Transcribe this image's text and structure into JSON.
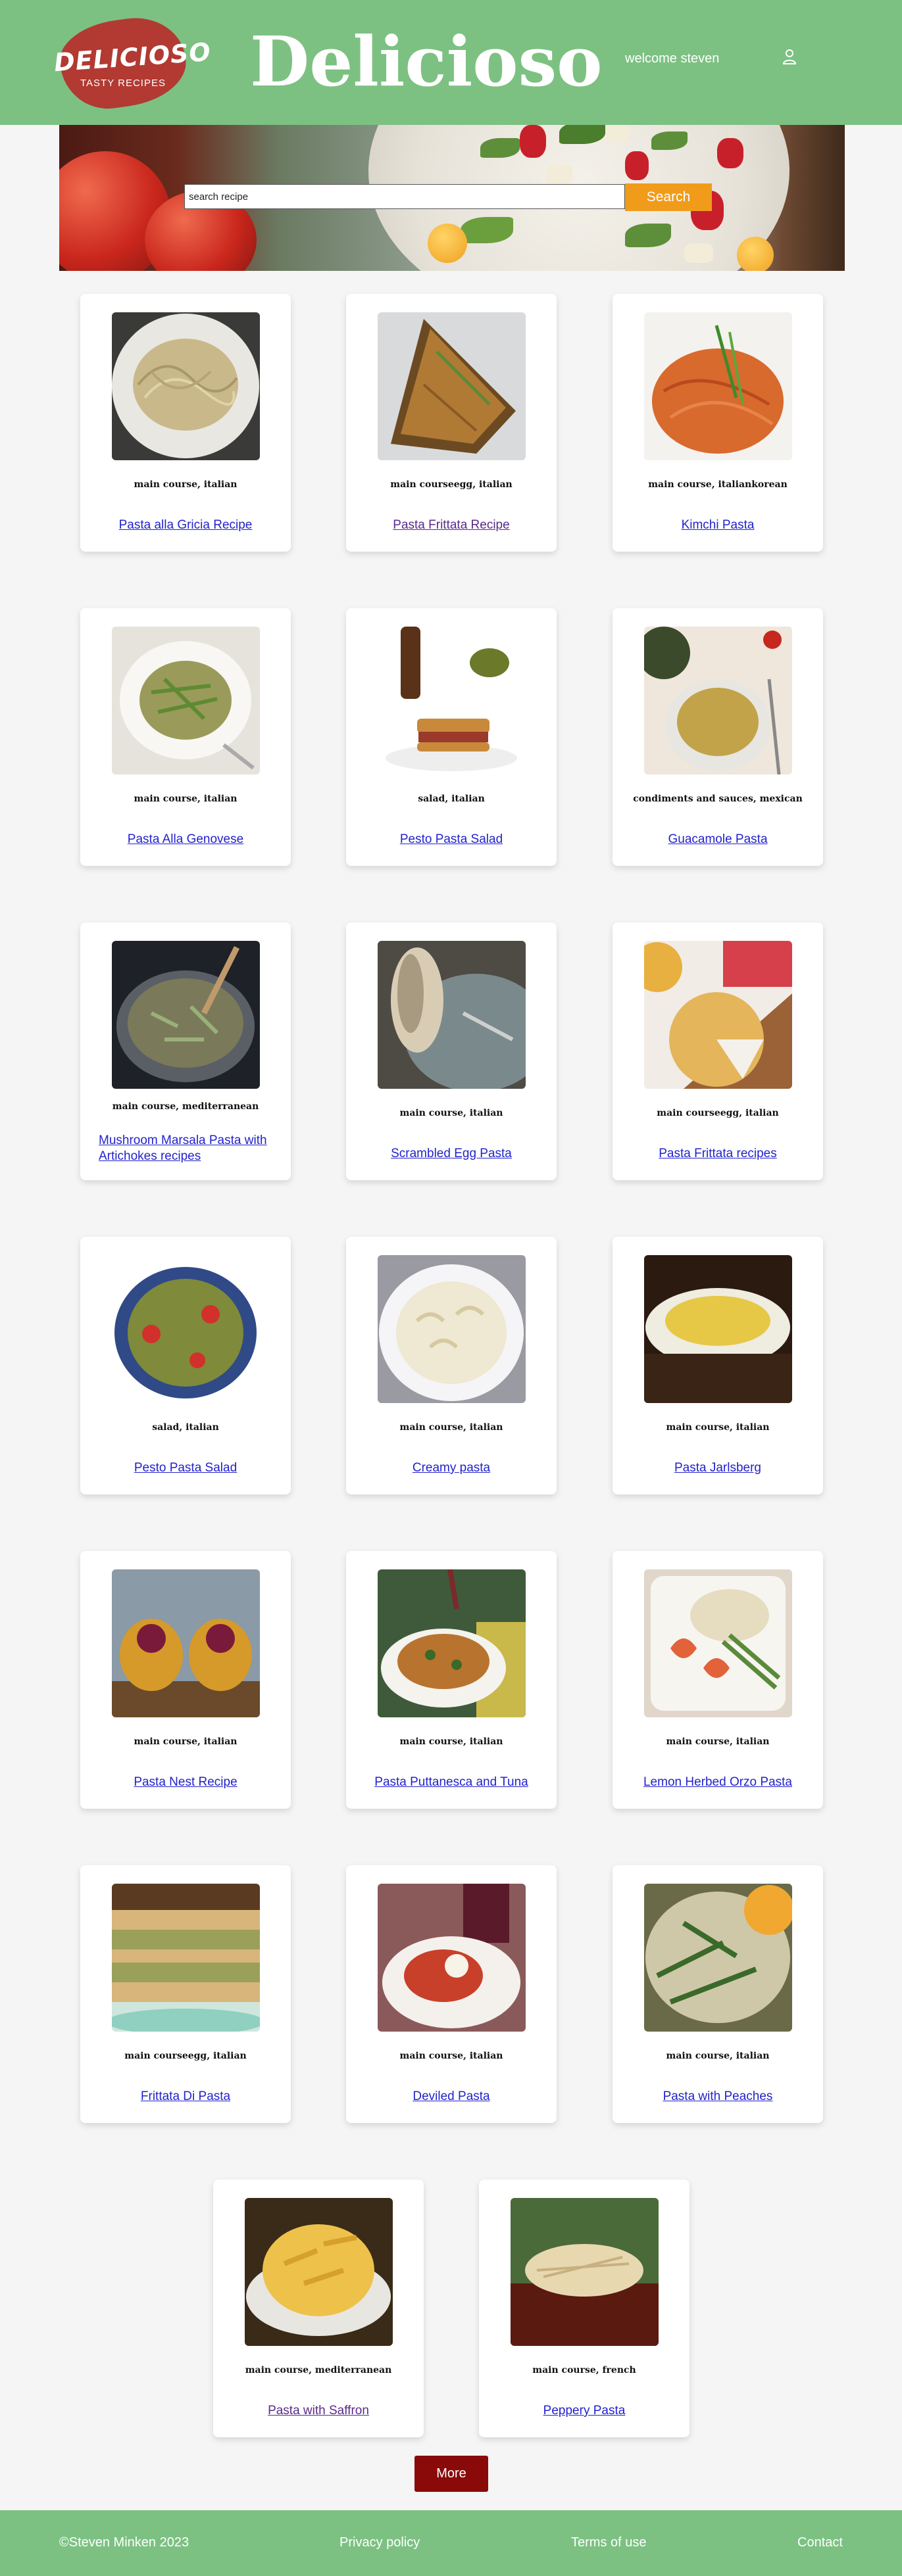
{
  "header": {
    "logo_title": "DELICIOSO",
    "logo_subtitle": "TASTY RECIPES",
    "brand": "Delicioso",
    "welcome": "welcome steven",
    "user_icon": "user-icon"
  },
  "search": {
    "placeholder": "search recipe",
    "button_label": "Search"
  },
  "recipes": [
    {
      "category": "main course, italian",
      "title": "Pasta alla Gricia Recipe",
      "image": "spaghetti-bowl"
    },
    {
      "category": "main courseegg, italian",
      "title": "Pasta Frittata Recipe",
      "image": "frittata-slice"
    },
    {
      "category": "main course, italiankorean",
      "title": "Kimchi Pasta",
      "image": "red-spaghetti"
    },
    {
      "category": "main course, italian",
      "title": "Pasta Alla Genovese",
      "image": "green-bean-pasta"
    },
    {
      "category": "salad, italian",
      "title": "Pesto Pasta Salad",
      "image": "sandwich-drinks"
    },
    {
      "category": "condiments and sauces, mexican",
      "title": "Guacamole Pasta",
      "image": "guacamole-bowl"
    },
    {
      "category": "main course, mediterranean",
      "title": "Mushroom Marsala Pasta with Artichokes recipes",
      "image": "mushroom-pot"
    },
    {
      "category": "main course, italian",
      "title": "Scrambled Egg Pasta",
      "image": "egg-pasta-plate"
    },
    {
      "category": "main courseegg, italian",
      "title": "Pasta Frittata recipes",
      "image": "frittata-board"
    },
    {
      "category": "salad, italian",
      "title": "Pesto Pasta Salad",
      "image": "pesto-salad"
    },
    {
      "category": "main course, italian",
      "title": "Creamy pasta",
      "image": "creamy-macaroni"
    },
    {
      "category": "main course, italian",
      "title": "Pasta Jarlsberg",
      "image": "spaghetti-plate"
    },
    {
      "category": "main course, italian",
      "title": "Pasta Nest Recipe",
      "image": "pasta-nests"
    },
    {
      "category": "main course, italian",
      "title": "Pasta Puttanesca and Tuna",
      "image": "puttanesca-bowl"
    },
    {
      "category": "main course, italian",
      "title": "Lemon Herbed Orzo Pasta",
      "image": "shrimp-orzo"
    },
    {
      "category": "main courseegg, italian",
      "title": "Frittata Di Pasta",
      "image": "green-lasagna"
    },
    {
      "category": "main course, italian",
      "title": "Deviled Pasta",
      "image": "deviled-pasta"
    },
    {
      "category": "main course, italian",
      "title": "Pasta with Peaches",
      "image": "peach-pasta"
    },
    {
      "category": "main course, mediterranean",
      "title": "Pasta with Saffron",
      "image": "saffron-penne"
    },
    {
      "category": "main course, french",
      "title": "Peppery Pasta",
      "image": "peppery-pasta"
    }
  ],
  "more_label": "More",
  "footer": {
    "copyright": "©Steven Minken 2023",
    "privacy": "Privacy policy",
    "terms": "Terms of use",
    "contact": "Contact"
  }
}
